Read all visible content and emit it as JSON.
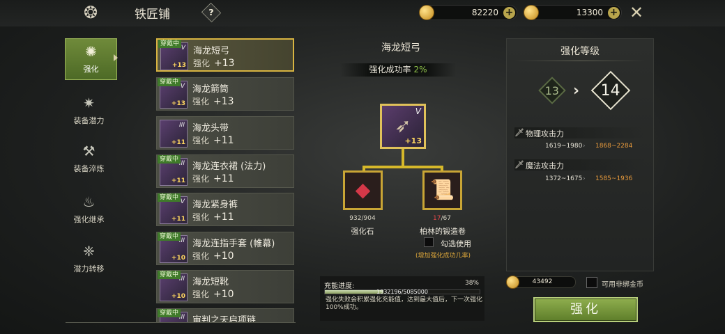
{
  "header": {
    "emblem_icon": "dragon-emblem-icon",
    "title": "铁匠铺",
    "help_label": "?",
    "currencies": [
      {
        "icon": "gold-coin-icon",
        "value": "82220"
      },
      {
        "icon": "gem-coin-icon",
        "value": "13300"
      }
    ],
    "close_icon": "crossed-swords-close-icon"
  },
  "sidebar": {
    "items": [
      {
        "label": "强化",
        "icon": "enhance-icon",
        "active": true
      },
      {
        "label": "装备潜力",
        "icon": "potential-icon",
        "active": false
      },
      {
        "label": "装备淬炼",
        "icon": "anvil-icon",
        "active": false
      },
      {
        "label": "强化继承",
        "icon": "inherit-icon",
        "active": false
      },
      {
        "label": "潜力转移",
        "icon": "transfer-icon",
        "active": false
      }
    ]
  },
  "equipment_list": {
    "level_prefix": "强化",
    "items": [
      {
        "badge": "穿戴中",
        "name": "海龙短弓",
        "level": "+13",
        "thumb_level": "+13",
        "roman": "V"
      },
      {
        "badge": "穿戴中",
        "name": "海龙箭筒",
        "level": "+13",
        "thumb_level": "+13",
        "roman": "V"
      },
      {
        "badge": "",
        "name": "海龙头带",
        "level": "+11",
        "thumb_level": "+11",
        "roman": "III"
      },
      {
        "badge": "穿戴中",
        "name": "海龙连衣裙 (法力)",
        "level": "+11",
        "thumb_level": "+11",
        "roman": "III"
      },
      {
        "badge": "穿戴中",
        "name": "海龙紧身裤",
        "level": "+11",
        "thumb_level": "+11",
        "roman": "V"
      },
      {
        "badge": "穿戴中",
        "name": "海龙连指手套 (帷幕)",
        "level": "+10",
        "thumb_level": "+10",
        "roman": "III"
      },
      {
        "badge": "穿戴中",
        "name": "海龙短靴",
        "level": "+10",
        "thumb_level": "+10",
        "roman": "III"
      },
      {
        "badge": "穿戴中",
        "name": "审判之天启项链",
        "level": "",
        "thumb_level": "",
        "roman": "III"
      }
    ]
  },
  "center": {
    "item_title": "海龙短弓",
    "rate_label": "强化成功率",
    "rate_value": "2%",
    "main_item": {
      "level": "+13",
      "roman": "V",
      "icon": "bow-icon"
    },
    "materials": [
      {
        "name": "强化石",
        "owned": "932",
        "sep": "/904",
        "icon": "red-crystal-icon",
        "insufficient": false
      },
      {
        "name": "柏林的锻造卷",
        "owned": "17",
        "sep": "/67",
        "icon": "scroll-icon",
        "insufficient": true
      }
    ],
    "optional_label": "勾选使用",
    "optional_hint": "(增加强化成功几率)"
  },
  "charge": {
    "label": "充能进度:",
    "percent": "38%",
    "progress": 0.38,
    "numbers": "1932196/5085000",
    "description": "强化失败会积累强化充能值，达到最大值后，下一次强化100%成功。"
  },
  "upgrade": {
    "title": "强化等级",
    "from_level": "13",
    "to_level": "14",
    "stats": [
      {
        "icon": "sword-icon",
        "label": "物理攻击力",
        "old": "1619~1980",
        "new": "1868~2284"
      },
      {
        "icon": "sword-icon",
        "label": "魔法攻击力",
        "old": "1372~1675",
        "new": "1585~1936"
      }
    ]
  },
  "footer": {
    "gold_icon": "gold-coin-icon",
    "gold_value": "43492",
    "nonbound_label": "可用非绑金币",
    "enhance_button": "强化"
  }
}
